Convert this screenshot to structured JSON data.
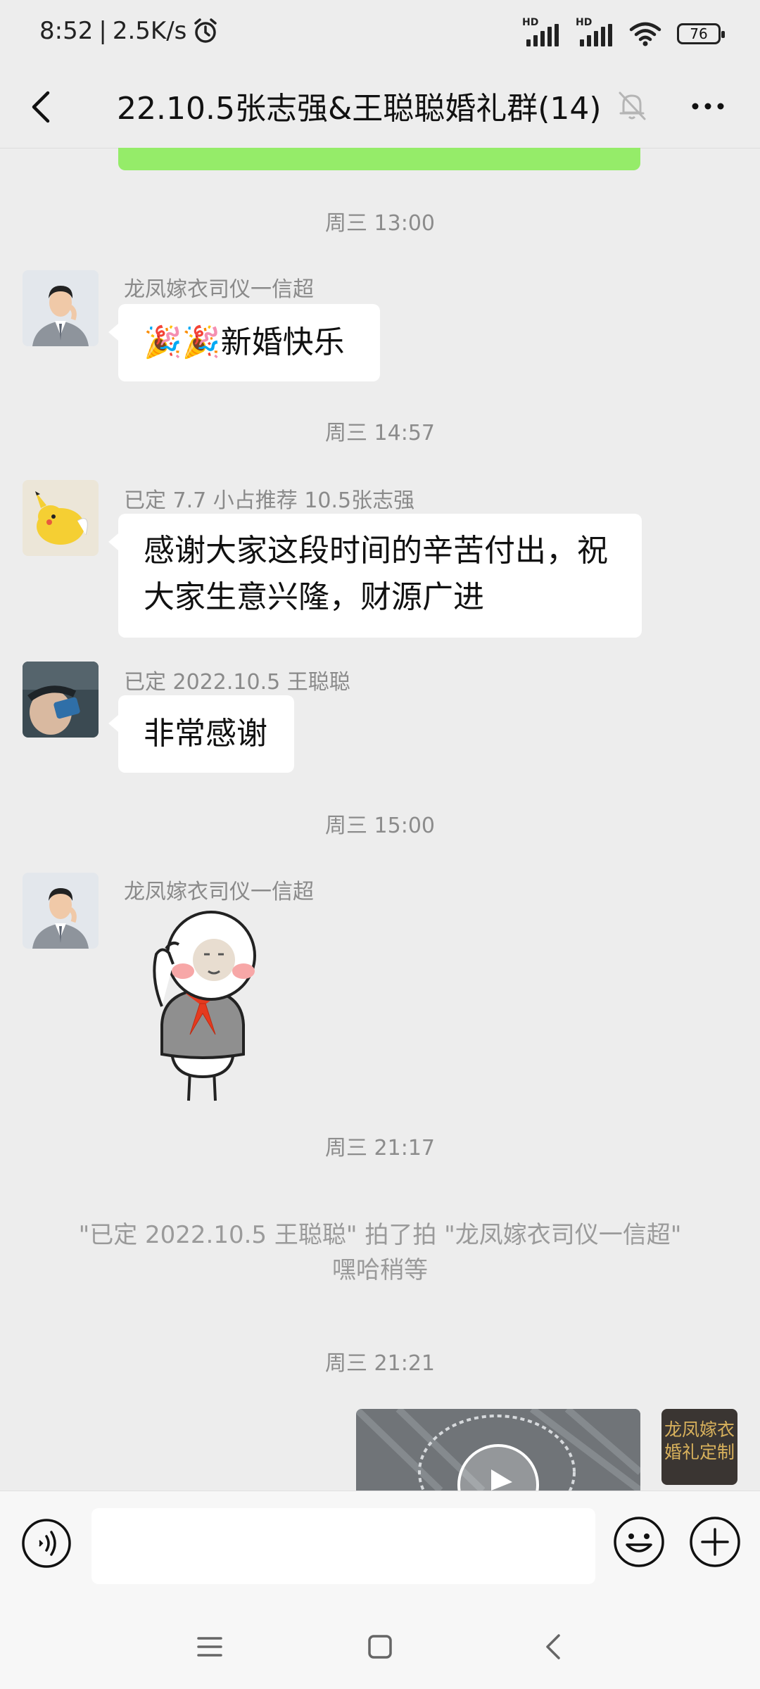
{
  "status_bar": {
    "time": "8:52",
    "speed": "2.5K/s",
    "hd1": "HD",
    "hd2": "HD",
    "battery": "76"
  },
  "header": {
    "title": "22.10.5张志强&王聪聪婚礼群(14)"
  },
  "messages": {
    "t1": "周三 13:00",
    "m1_sender": "龙凤嫁衣司仪一信超",
    "m1_text": "🎉🎉新婚快乐",
    "t2": "周三 14:57",
    "m2_sender": "已定 7.7 小占推荐 10.5张志强",
    "m2_text": "感谢大家这段时间的辛苦付出，祝大家生意兴隆，财源广进",
    "m3_sender": "已定 2022.10.5 王聪聪",
    "m3_text": "非常感谢",
    "t3": "周三 15:00",
    "m4_sender": "龙凤嫁衣司仪一信超",
    "t4": "周三 21:17",
    "system_pat": "\"已定 2022.10.5 王聪聪\" 拍了拍 \"龙凤嫁衣司仪一信超\" 嘿哈稍等",
    "t5": "周三 21:21",
    "logo_line1": "龙凤嫁衣",
    "logo_line2": "婚礼定制"
  },
  "input": {
    "placeholder": ""
  },
  "colors": {
    "bg": "#ededed",
    "bubble_self": "#95ec69",
    "bubble_other": "#ffffff"
  }
}
